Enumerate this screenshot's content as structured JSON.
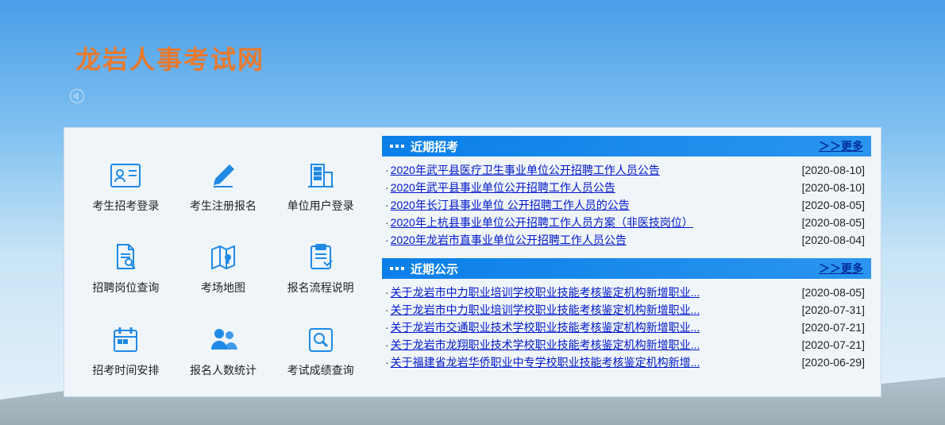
{
  "site_title": "龙岩人事考试网",
  "grid": [
    {
      "label": "考生招考登录"
    },
    {
      "label": "考生注册报名"
    },
    {
      "label": "单位用户登录"
    },
    {
      "label": "招聘岗位查询"
    },
    {
      "label": "考场地图"
    },
    {
      "label": "报名流程说明"
    },
    {
      "label": "招考时间安排"
    },
    {
      "label": "报名人数统计"
    },
    {
      "label": "考试成绩查询"
    }
  ],
  "sections": {
    "recruit": {
      "title": "近期招考",
      "more": "＞＞更多",
      "items": [
        {
          "title": "2020年武平县医疗卫生事业单位公开招聘工作人员公告",
          "date": "[2020-08-10]"
        },
        {
          "title": "2020年武平县事业单位公开招聘工作人员公告",
          "date": "[2020-08-10]"
        },
        {
          "title": "2020年长汀县事业单位 公开招聘工作人员的公告",
          "date": "[2020-08-05]"
        },
        {
          "title": "2020年上杭县事业单位公开招聘工作人员方案（非医技岗位）",
          "date": "[2020-08-05]"
        },
        {
          "title": "2020年龙岩市直事业单位公开招聘工作人员公告",
          "date": "[2020-08-04]"
        }
      ]
    },
    "notice": {
      "title": "近期公示",
      "more": "＞＞更多",
      "items": [
        {
          "title": "关于龙岩市中力职业培训学校职业技能考核鉴定机构新增职业...",
          "date": "[2020-08-05]"
        },
        {
          "title": "关于龙岩市中力职业培训学校职业技能考核鉴定机构新增职业...",
          "date": "[2020-07-31]"
        },
        {
          "title": "关于龙岩市交通职业技术学校职业技能考核鉴定机构新增职业...",
          "date": "[2020-07-21]"
        },
        {
          "title": "关于龙岩市龙翔职业技术学校职业技能考核鉴定机构新增职业...",
          "date": "[2020-07-21]"
        },
        {
          "title": "关于福建省龙岩华侨职业中专学校职业技能考核鉴定机构新增...",
          "date": "[2020-06-29]"
        }
      ]
    }
  }
}
